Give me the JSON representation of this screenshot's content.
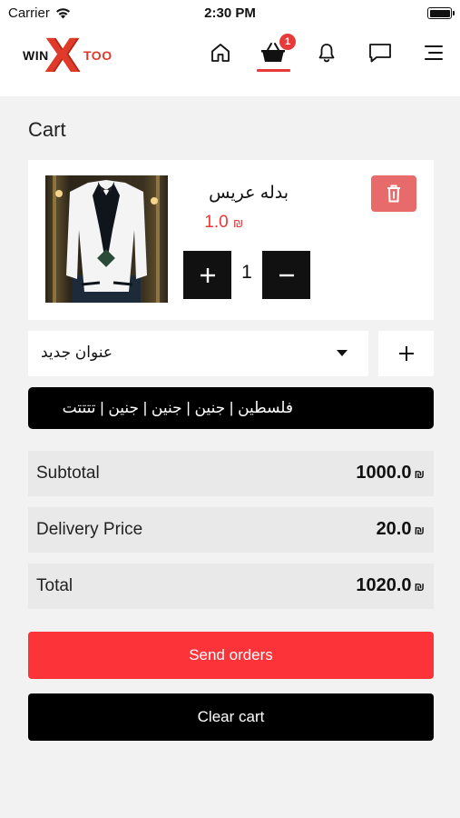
{
  "status_bar": {
    "carrier": "Carrier",
    "time": "2:30 PM"
  },
  "header": {
    "logo": {
      "win": "WIN",
      "x": "X",
      "too": "TOO"
    },
    "nav": [
      {
        "icon": "home-icon"
      },
      {
        "icon": "basket-icon",
        "active": true,
        "badge": "1"
      },
      {
        "icon": "bell-icon"
      },
      {
        "icon": "chat-icon"
      },
      {
        "icon": "menu-icon"
      }
    ]
  },
  "page": {
    "title": "Cart"
  },
  "cart": {
    "items": [
      {
        "name": "بدله عريس",
        "price": "1.0",
        "currency": "₪",
        "quantity": "1"
      }
    ]
  },
  "address": {
    "selected": "عنوان جديد",
    "line": "فلسطين | جنين | جنين | جنين | تتتتت"
  },
  "summary": {
    "subtotal": {
      "label": "Subtotal",
      "value": "1000.0",
      "currency": "₪"
    },
    "delivery": {
      "label": "Delivery Price",
      "value": "20.0",
      "currency": "₪"
    },
    "total": {
      "label": "Total",
      "value": "1020.0",
      "currency": "₪"
    }
  },
  "actions": {
    "send": "Send orders",
    "clear": "Clear cart"
  },
  "colors": {
    "accent": "#fc3339",
    "delete": "#e86b6b",
    "dark": "#000000"
  }
}
